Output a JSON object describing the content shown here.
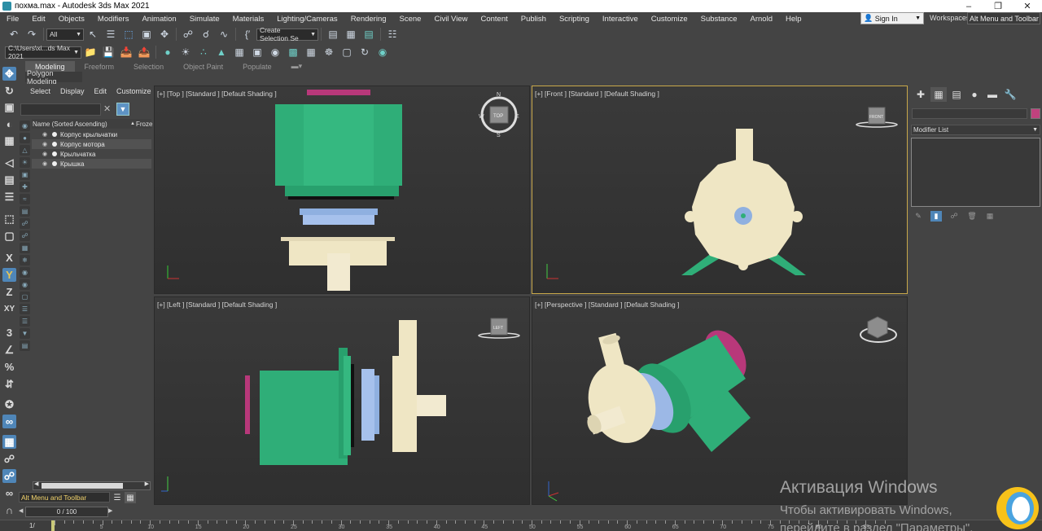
{
  "window": {
    "title": "похма.max - Autodesk 3ds Max 2021"
  },
  "menu": [
    "File",
    "Edit",
    "Objects",
    "Modifiers",
    "Animation",
    "Simulate",
    "Materials",
    "Lighting/Cameras",
    "Rendering",
    "Scene",
    "Civil View",
    "Content",
    "Publish",
    "Scripting",
    "Interactive",
    "Customize",
    "Substance",
    "Arnold",
    "Help"
  ],
  "signin": {
    "label": "Sign In"
  },
  "workspaces": {
    "label": "Workspaces:",
    "value": "Alt Menu and Toolbar"
  },
  "toolbar": {
    "selection_filter": "All",
    "selection_set": "Create Selection Se",
    "project_path": "C:\\Users\\xi...ds Max 2021"
  },
  "ribbon": {
    "tabs": [
      "Modeling",
      "Freeform",
      "Selection",
      "Object Paint",
      "Populate"
    ],
    "sub": "Polygon Modeling"
  },
  "explorer": {
    "tabs": [
      "Select",
      "Display",
      "Edit",
      "Customize"
    ],
    "column": "Name (Sorted Ascending)",
    "frozen_col": "Froze",
    "rows": [
      "Корпус крыльчатки",
      "Корпус мотора",
      "Крыльчатка",
      "Крышка"
    ]
  },
  "viewports": {
    "top": "[+] [Top ] [Standard ] [Default Shading ]",
    "front": "[+] [Front ] [Standard ] [Default Shading ]",
    "left": "[+] [Left ] [Standard ] [Default Shading ]",
    "perspective": "[+] [Perspective ] [Standard ] [Default Shading ]",
    "cube_top": "TOP",
    "cube_front": "FRONT",
    "cube_left": "LEFT",
    "compass": {
      "n": "N",
      "s": "S",
      "e": "E",
      "w": "W"
    }
  },
  "command_panel": {
    "modifier_list": "Modifier List",
    "object_color": "#c0427e"
  },
  "bottom": {
    "workspace": "Alt Menu and Toolbar",
    "frame_counter": "0 / 100",
    "ruler_ticks": [
      "5",
      "10",
      "15",
      "20",
      "25",
      "30",
      "35",
      "40",
      "45",
      "50",
      "55",
      "60",
      "65",
      "70",
      "75",
      "80",
      "85"
    ]
  },
  "colors": {
    "green": "#2fae78",
    "cream": "#efe6c4",
    "blue": "#9cb8e6",
    "magenta": "#c0427e",
    "accent": "#4f86b8"
  },
  "watermark": {
    "title": "Активация Windows",
    "line1": "Чтобы активировать Windows,",
    "line2": "перейдите в раздел \"Параметры\"."
  }
}
